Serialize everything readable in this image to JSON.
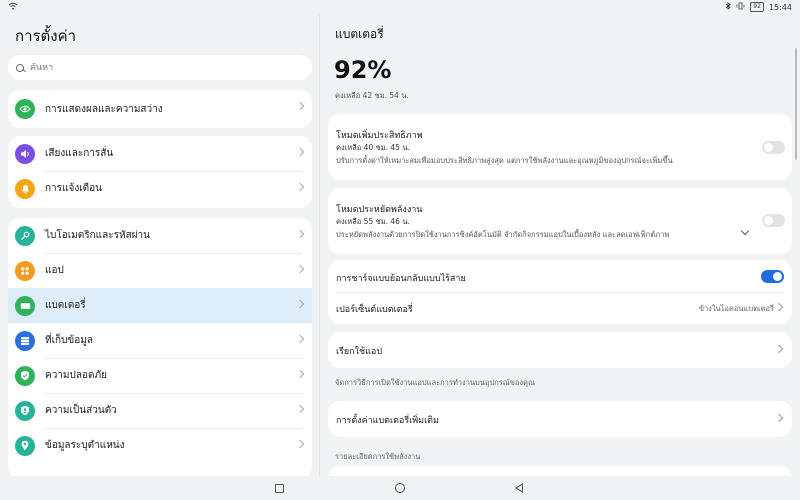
{
  "status_bar": {
    "wifi_icon": "wifi-icon",
    "bluetooth_icon": "bluetooth-icon",
    "vibrate_icon": "vibrate-icon",
    "battery_badge": "92",
    "time": "15:44"
  },
  "left": {
    "title": "การตั้งค่า",
    "search_placeholder": "ค้นหา",
    "items": [
      {
        "label": "การแสดงผลและความสว่าง",
        "icon": "eye-icon",
        "color": "#2fb25a"
      },
      {
        "label": "เสียงและการสั่น",
        "icon": "speaker-icon",
        "color": "#7b4fe6"
      },
      {
        "label": "การแจ้งเตือน",
        "icon": "bell-icon",
        "color": "#f5a517"
      },
      {
        "label": "ไบโอเมตริกและรหัสผ่าน",
        "icon": "key-icon",
        "color": "#27b29a"
      },
      {
        "label": "แอป",
        "icon": "apps-icon",
        "color": "#f59b20"
      },
      {
        "label": "แบตเตอรี่",
        "icon": "battery-icon",
        "color": "#2fb25a"
      },
      {
        "label": "ที่เก็บข้อมูล",
        "icon": "storage-icon",
        "color": "#2b6fe0"
      },
      {
        "label": "ความปลอดภัย",
        "icon": "shield-icon",
        "color": "#2fb25a"
      },
      {
        "label": "ความเป็นส่วนตัว",
        "icon": "privacy-icon",
        "color": "#27b29a"
      },
      {
        "label": "ข้อมูลระบุตำแหน่ง",
        "icon": "location-icon",
        "color": "#27b29a"
      }
    ]
  },
  "right": {
    "title": "แบตเตอรี่",
    "percent": "92%",
    "remaining": "คงเหลือ 42 ชม. 54 น.",
    "performance_mode": {
      "title": "โหมดเพิ่มประสิทธิภาพ",
      "remaining": "คงเหลือ 40 ชม. 45 น.",
      "desc": "ปรับการตั้งค่าให้เหมาะสมเพื่อมอบประสิทธิภาพสูงสุด แต่การใช้พลังงานและอุณหภูมิของอุปกรณ์จะเพิ่มขึ้น"
    },
    "power_saving_mode": {
      "title": "โหมดประหยัดพลังงาน",
      "remaining": "คงเหลือ 55 ชม. 46 น.",
      "desc": "ประหยัดพลังงานด้วยการปิดใช้งานการซิงค์อัตโนมัติ จำกัดกิจกรรมแอปในเบื้องหลัง และลดเอฟเฟ็กต์ภาพ"
    },
    "reverse_wireless_charging": "การชาร์จแบบย้อนกลับแบบไร้สาย",
    "battery_percentage": {
      "label": "เปอร์เซ็นต์แบตเตอรี่",
      "value": "ข้างในไอคอนแบตเตอรี่"
    },
    "app_launch": "เรียกใช้แอป",
    "app_launch_note": "จัดการวิธีการเปิดใช้งานแอปและการทำงานบนอุปกรณ์ของคุณ",
    "more_settings": "การตั้งค่าแบตเตอรี่เพิ่มเติม",
    "usage_details": "รายละเอียดการใช้พลังงาน"
  },
  "toggles": {
    "performance_mode": false,
    "power_saving_mode": false,
    "reverse_wireless_charging": true
  },
  "nav": {
    "back_icon": "square-icon",
    "home_icon": "circle-icon",
    "recent_icon": "triangle-icon"
  }
}
